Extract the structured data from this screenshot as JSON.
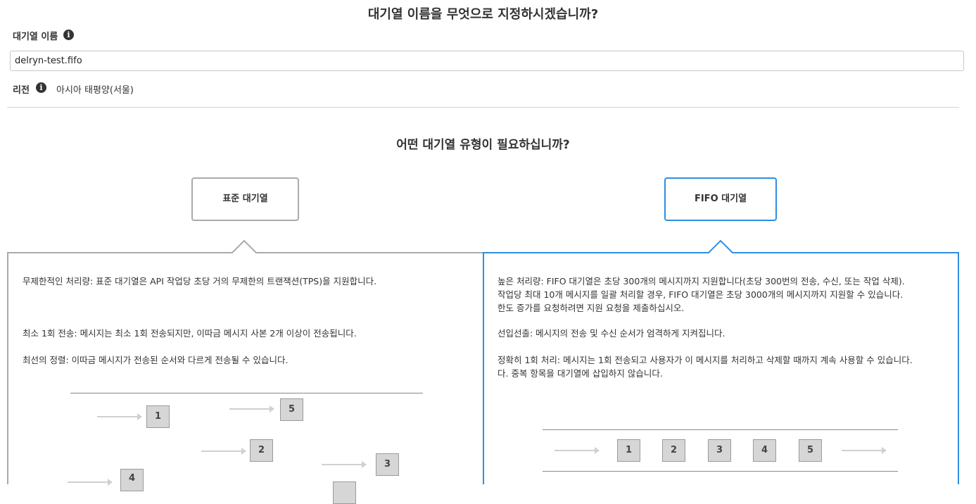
{
  "header": {
    "title": "대기열 이름을 무엇으로 지정하시겠습니까?"
  },
  "queue_name": {
    "label": "대기열 이름",
    "value": "delryn-test.fifo"
  },
  "region": {
    "label": "리전",
    "value": "아시아 태평양(서울)"
  },
  "queue_type": {
    "title": "어떤 대기열 유형이 필요하십니까?",
    "selected": "FIFO 대기열",
    "standard": {
      "label": "표준 대기열",
      "lines": [
        "무제한적인 처리량: 표준 대기열은 API 작업당 초당 거의 무제한의 트랜잭션(TPS)을 지원합니다.",
        "최소 1회 전송: 메시지는 최소 1회 전송되지만, 이따금 메시지 사본 2개 이상이 전송됩니다.",
        "최선의 정렬: 이따금 메시지가 전송된 순서와 다르게 전송될 수 있습니다."
      ],
      "diagram_boxes": [
        "1",
        "5",
        "2",
        "3",
        "4"
      ]
    },
    "fifo": {
      "label": "FIFO 대기열",
      "paragraphs": [
        [
          "높은 처리량: FIFO 대기열은 초당 300개의 메시지까지 지원합니다(초당 300번의 전송, 수신, 또는 작업 삭제).",
          "작업당 최대 10개 메시지를 일괄 처리할 경우, FIFO 대기열은 초당 3000개의 메시지까지 지원할 수 있습니다.",
          "한도 증가를 요청하려면 지원 요청을 제출하십시오."
        ],
        [
          "선입선출: 메시지의 전송 및 수신 순서가 엄격하게 지켜집니다."
        ],
        [
          "정확히 1회 처리: 메시지는 1회 전송되고 사용자가 이 메시지를 처리하고 삭제할 때까지 계속 사용할 수 있습니다.",
          "다. 중복 항목을 대기열에 삽입하지 않습니다."
        ]
      ],
      "diagram_boxes": [
        "1",
        "2",
        "3",
        "4",
        "5"
      ]
    }
  },
  "colors": {
    "accent": "#2e8fe0",
    "panel_border": "#aaaaaa",
    "box_fill": "#d6d6d6"
  }
}
